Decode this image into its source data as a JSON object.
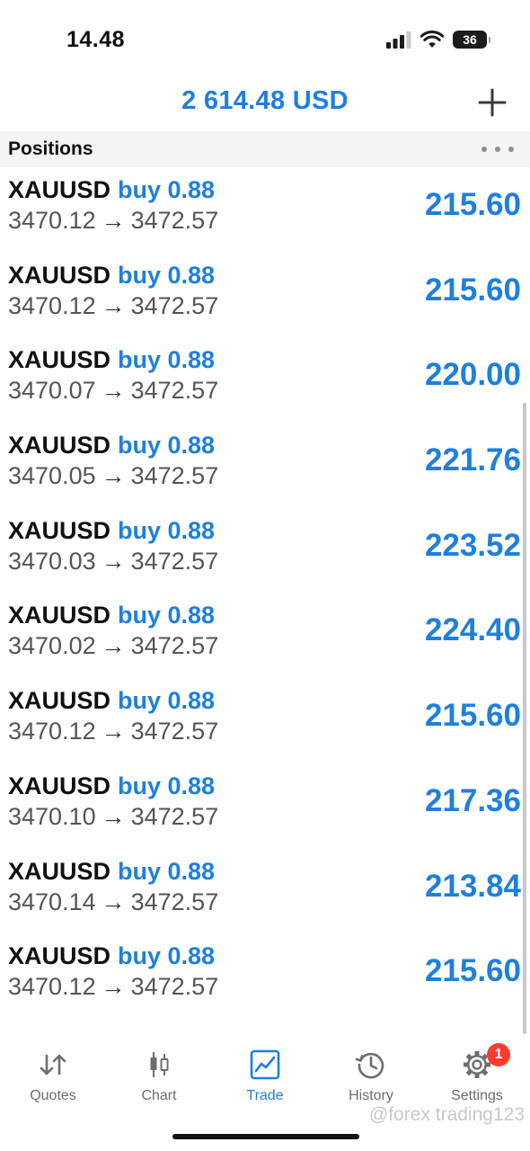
{
  "status_bar": {
    "time": "14.48",
    "battery": "36",
    "icons": [
      "signal-icon",
      "wifi-icon",
      "battery-icon"
    ]
  },
  "header": {
    "balance": "2 614.48 USD",
    "add_icon": "plus-icon"
  },
  "section": {
    "title": "Positions",
    "menu_icon": "more-icon"
  },
  "positions": [
    {
      "symbol": "XAUUSD",
      "side": "buy 0.88",
      "open_price": "3470.12",
      "arrow": "→",
      "current_price": "3472.57",
      "profit": "215.60"
    },
    {
      "symbol": "XAUUSD",
      "side": "buy 0.88",
      "open_price": "3470.12",
      "arrow": "→",
      "current_price": "3472.57",
      "profit": "215.60"
    },
    {
      "symbol": "XAUUSD",
      "side": "buy 0.88",
      "open_price": "3470.07",
      "arrow": "→",
      "current_price": "3472.57",
      "profit": "220.00"
    },
    {
      "symbol": "XAUUSD",
      "side": "buy 0.88",
      "open_price": "3470.05",
      "arrow": "→",
      "current_price": "3472.57",
      "profit": "221.76"
    },
    {
      "symbol": "XAUUSD",
      "side": "buy 0.88",
      "open_price": "3470.03",
      "arrow": "→",
      "current_price": "3472.57",
      "profit": "223.52"
    },
    {
      "symbol": "XAUUSD",
      "side": "buy 0.88",
      "open_price": "3470.02",
      "arrow": "→",
      "current_price": "3472.57",
      "profit": "224.40"
    },
    {
      "symbol": "XAUUSD",
      "side": "buy 0.88",
      "open_price": "3470.12",
      "arrow": "→",
      "current_price": "3472.57",
      "profit": "215.60"
    },
    {
      "symbol": "XAUUSD",
      "side": "buy 0.88",
      "open_price": "3470.10",
      "arrow": "→",
      "current_price": "3472.57",
      "profit": "217.36"
    },
    {
      "symbol": "XAUUSD",
      "side": "buy 0.88",
      "open_price": "3470.14",
      "arrow": "→",
      "current_price": "3472.57",
      "profit": "213.84"
    },
    {
      "symbol": "XAUUSD",
      "side": "buy 0.88",
      "open_price": "3470.12",
      "arrow": "→",
      "current_price": "3472.57",
      "profit": "215.60"
    }
  ],
  "tabs": [
    {
      "label": "Quotes",
      "icon": "quotes-icon",
      "active": false
    },
    {
      "label": "Chart",
      "icon": "chart-icon",
      "active": false
    },
    {
      "label": "Trade",
      "icon": "trade-icon",
      "active": true
    },
    {
      "label": "History",
      "icon": "history-icon",
      "active": false
    },
    {
      "label": "Settings",
      "icon": "settings-icon",
      "active": false,
      "badge": "1"
    }
  ],
  "watermark": "@forex trading123",
  "colors": {
    "accent": "#1e7fe0",
    "badge": "#ff3b30",
    "text": "#111111",
    "muted": "#6d6d72"
  }
}
